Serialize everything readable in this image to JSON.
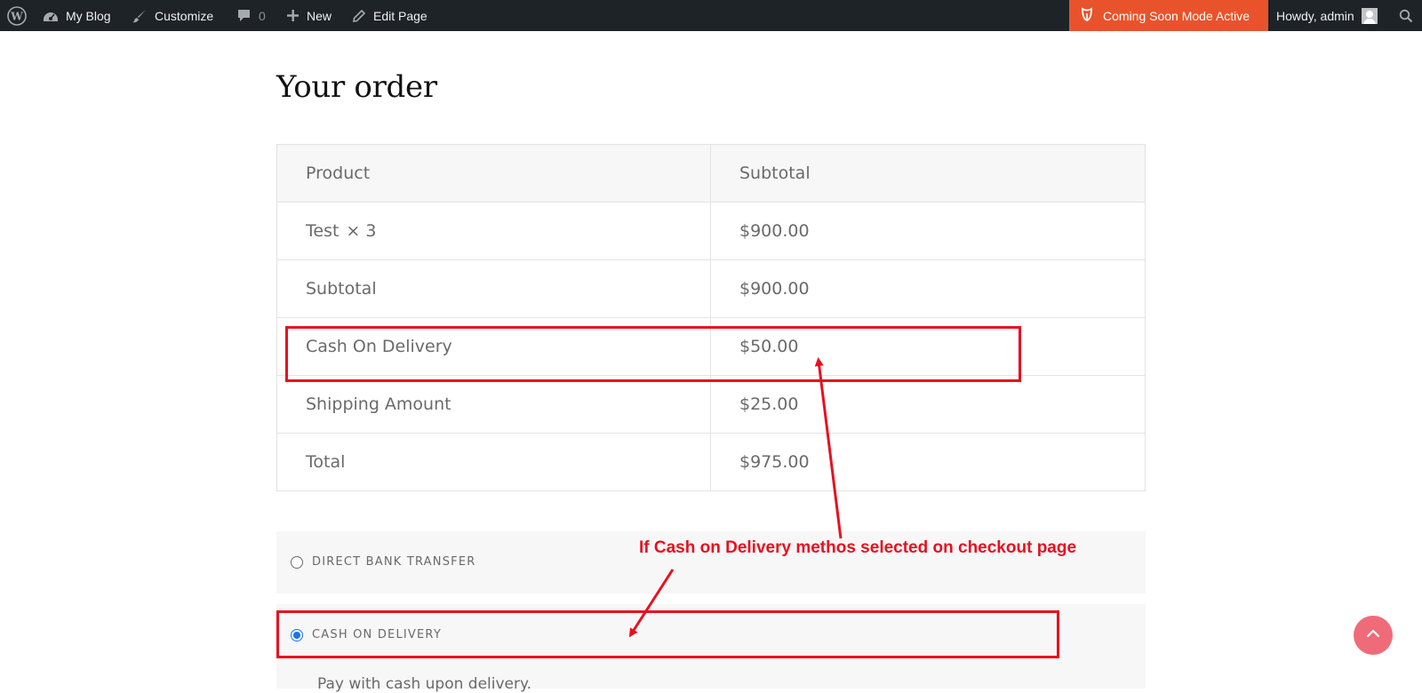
{
  "adminbar": {
    "site_name": "My Blog",
    "customize_label": "Customize",
    "comments_count": "0",
    "new_label": "New",
    "edit_label": "Edit Page",
    "coming_soon_label": "Coming Soon Mode Active",
    "account_label": "Howdy, admin"
  },
  "order": {
    "heading": "Your order",
    "headers": {
      "product": "Product",
      "subtotal": "Subtotal"
    },
    "item": {
      "name": "Test",
      "qty": "× 3",
      "amount": "$900.00"
    },
    "rows": [
      {
        "label": "Subtotal",
        "amount": "$900.00"
      },
      {
        "label": "Cash On Delivery",
        "amount": "$50.00"
      },
      {
        "label": "Shipping Amount",
        "amount": "$25.00"
      },
      {
        "label": "Total",
        "amount": "$975.00"
      }
    ]
  },
  "payment": {
    "methods": [
      {
        "label": "DIRECT BANK TRANSFER",
        "selected": false
      },
      {
        "label": "CASH ON DELIVERY",
        "selected": true,
        "description": "Pay with cash upon delivery."
      }
    ]
  },
  "annotation": {
    "text": "If Cash on Delivery methos selected on checkout page",
    "color": "#e8101f"
  },
  "colors": {
    "adminbar_bg": "#1d2327",
    "coming_soon_bg": "#e8532b",
    "scroll_top_bg": "#f06b7a",
    "radio_selected": "#1a73e8"
  }
}
